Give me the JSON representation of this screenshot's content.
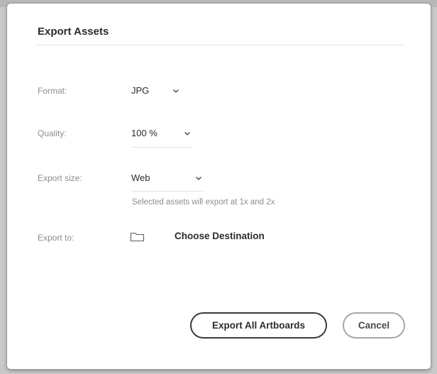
{
  "dialog": {
    "title": "Export Assets",
    "format": {
      "label": "Format:",
      "value": "JPG"
    },
    "quality": {
      "label": "Quality:",
      "value": "100 %"
    },
    "export_size": {
      "label": "Export size:",
      "value": "Web",
      "hint": "Selected assets will export at 1x and 2x"
    },
    "export_to": {
      "label": "Export to:",
      "icon": "folder-icon",
      "action": "Choose Destination"
    },
    "buttons": {
      "primary": "Export All Artboards",
      "secondary": "Cancel"
    }
  }
}
